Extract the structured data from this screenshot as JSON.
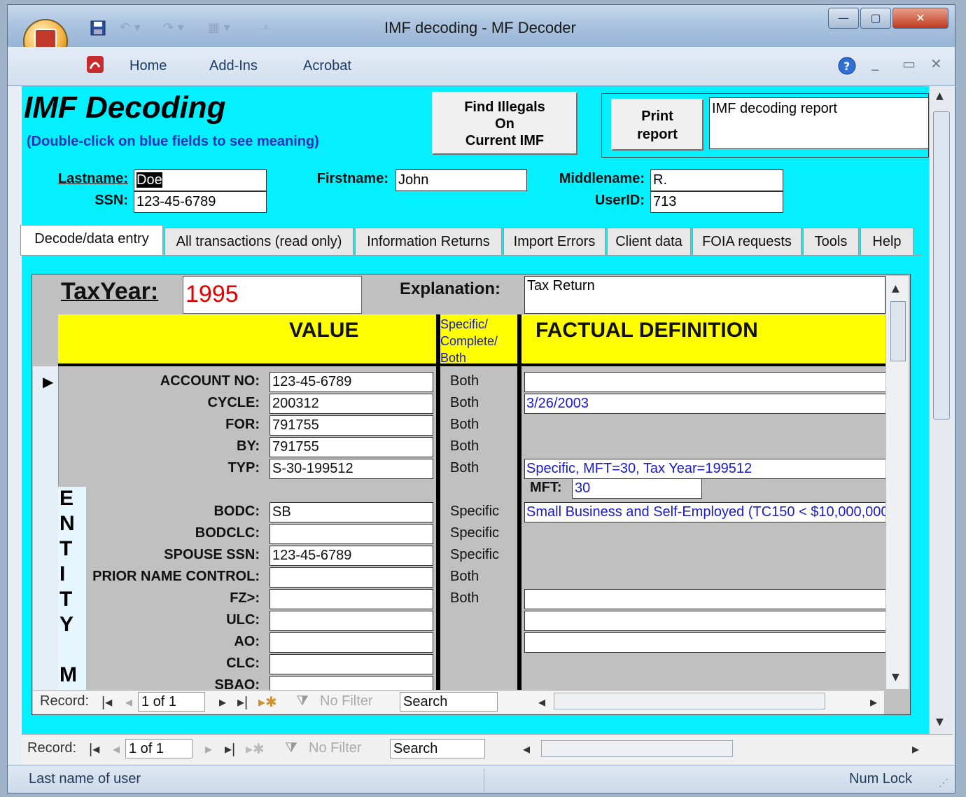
{
  "window": {
    "title": "IMF decoding - MF Decoder",
    "controls": [
      "—",
      "▢",
      "✕"
    ]
  },
  "ribbon": {
    "menus": [
      "Home",
      "Add-Ins",
      "Acrobat"
    ]
  },
  "header": {
    "title": "IMF Decoding",
    "subtitle": "(Double-click on blue fields to see meaning)",
    "find_button": [
      "Find Illegals",
      "On",
      "Current IMF"
    ],
    "print_button": [
      "Print",
      "report"
    ],
    "report_name": "IMF decoding report"
  },
  "client": {
    "lastname_label": "Lastname:",
    "lastname": "Doe",
    "ssn_label": "SSN:",
    "ssn": "123-45-6789",
    "firstname_label": "Firstname:",
    "firstname": "John",
    "middlename_label": "Middlename:",
    "middlename": "R.",
    "userid_label": "UserID:",
    "userid": "713"
  },
  "tabs": [
    {
      "label": "Decode/data entry",
      "active": true
    },
    {
      "label": "All transactions (read only)"
    },
    {
      "label": "Information Returns"
    },
    {
      "label": "Import Errors"
    },
    {
      "label": "Client data"
    },
    {
      "label": "FOIA requests"
    },
    {
      "label": "Tools"
    },
    {
      "label": "Help"
    }
  ],
  "subform": {
    "taxyear_label": "TaxYear:",
    "taxyear": "1995",
    "explanation_label": "Explanation:",
    "explanation": "Tax Return",
    "col_value": "VALUE",
    "col_scb": [
      "Specific/",
      "Complete/",
      "Both"
    ],
    "col_def": "FACTUAL DEFINITION",
    "entity_letters": [
      "E",
      "N",
      "T",
      "I",
      "T",
      "Y",
      "M"
    ],
    "mft_label": "MFT:",
    "mft_value": "30",
    "fields": [
      {
        "label": "ACCOUNT NO:",
        "value": "123-45-6789",
        "scb": "Both",
        "def": ""
      },
      {
        "label": "CYCLE:",
        "value": "200312",
        "scb": "Both",
        "def": "3/26/2003"
      },
      {
        "label": "FOR:",
        "value": "791755",
        "scb": "Both"
      },
      {
        "label": "BY:",
        "value": "791755",
        "scb": "Both"
      },
      {
        "label": "TYP:",
        "value": "S-30-199512",
        "scb": "Both",
        "def": "Specific, MFT=30, Tax Year=199512"
      },
      {
        "label": "BODC:",
        "value": "SB",
        "scb": "Specific",
        "def": "Small Business and Self-Employed (TC150 < $10,000,000"
      },
      {
        "label": "BODCLC:",
        "value": "",
        "scb": "Specific"
      },
      {
        "label": "SPOUSE SSN:",
        "value": "123-45-6789",
        "scb": "Specific"
      },
      {
        "label": "PRIOR NAME CONTROL:",
        "value": "",
        "scb": "Both"
      },
      {
        "label": "FZ>:",
        "value": "",
        "scb": "Both",
        "def": ""
      },
      {
        "label": "ULC:",
        "value": "",
        "scb": "",
        "def": ""
      },
      {
        "label": "AO:",
        "value": "",
        "scb": "",
        "def": ""
      },
      {
        "label": "CLC:",
        "value": "",
        "scb": ""
      },
      {
        "label": "SBAO:",
        "value": "",
        "scb": ""
      }
    ],
    "nav": {
      "record_label": "Record:",
      "record": "1 of 1",
      "filter": "No Filter",
      "search": "Search"
    }
  },
  "mainnav": {
    "record_label": "Record:",
    "record": "1 of 1",
    "filter": "No Filter",
    "search": "Search"
  },
  "status": {
    "left": "Last name of user",
    "right": "Num Lock"
  }
}
